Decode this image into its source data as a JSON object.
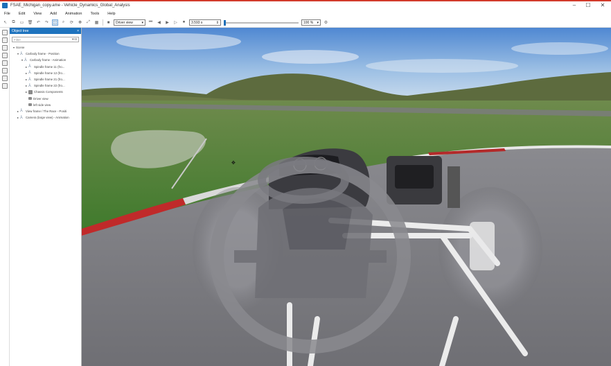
{
  "window": {
    "title": "FSAE_Michigan_copy.ame - Vehicle_Dynamics_Global_Analysis",
    "controls": [
      "–",
      "☐",
      "✕"
    ]
  },
  "menu": [
    "File",
    "Edit",
    "View",
    "Add",
    "Animation",
    "Tools",
    "Help"
  ],
  "toolbar": {
    "view_select": "Driver view",
    "time_value": "3.593 s",
    "zoom_select": "100 %"
  },
  "object_tree": {
    "header": "Object tree",
    "filter_placeholder": "Filter",
    "items": [
      {
        "label": "Scene",
        "depth": 0,
        "toggle": "▾",
        "icon": "none"
      },
      {
        "label": "Carbody frame - Position",
        "depth": 1,
        "toggle": "▾",
        "icon": "frame"
      },
      {
        "label": "Carbody frame - Animation",
        "depth": 2,
        "toggle": "▾",
        "icon": "frame"
      },
      {
        "label": "Spindle frame 11 (fro...",
        "depth": 3,
        "toggle": "▸",
        "icon": "frame"
      },
      {
        "label": "Spindle frame 12 (fro...",
        "depth": 3,
        "toggle": "▸",
        "icon": "frame"
      },
      {
        "label": "Spindle frame 21 (fro...",
        "depth": 3,
        "toggle": "▸",
        "icon": "frame"
      },
      {
        "label": "Spindle frame 22 (fro...",
        "depth": 3,
        "toggle": "▸",
        "icon": "frame"
      },
      {
        "label": "Chassis Components",
        "depth": 3,
        "toggle": "▸",
        "icon": "chassis"
      },
      {
        "label": "Driver view",
        "depth": 3,
        "toggle": "",
        "icon": "camera"
      },
      {
        "label": "left side view",
        "depth": 3,
        "toggle": "",
        "icon": "camera"
      },
      {
        "label": "View frame / The Race - Positi",
        "depth": 1,
        "toggle": "▸",
        "icon": "frame"
      },
      {
        "label": "Camera (large view) - Animation",
        "depth": 1,
        "toggle": "▸",
        "icon": "frame"
      }
    ]
  }
}
